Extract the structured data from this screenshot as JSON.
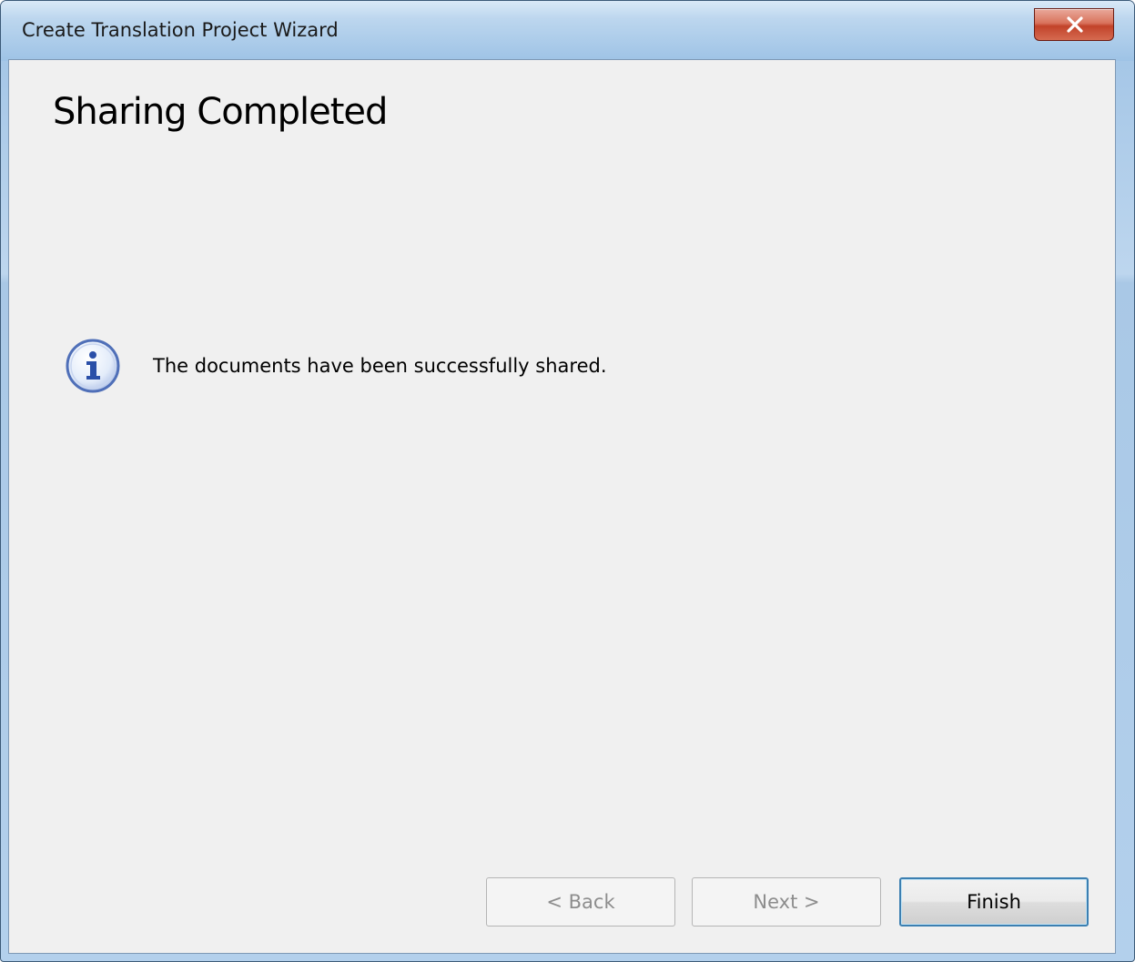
{
  "window": {
    "title": "Create Translation Project Wizard",
    "close_glyph": "x"
  },
  "page": {
    "heading": "Sharing Completed",
    "message": "The documents have been successfully shared.",
    "message_icon": "info-icon"
  },
  "buttons": {
    "back": {
      "label": "< Back",
      "enabled": false
    },
    "next": {
      "label": "Next >",
      "enabled": false
    },
    "finish": {
      "label": "Finish",
      "enabled": true,
      "default": true
    }
  },
  "colors": {
    "titlebar": "#a9c8e6",
    "client_background": "#f0f0f0",
    "close_button": "#c2432a",
    "default_button_border": "#3c7fb1"
  }
}
